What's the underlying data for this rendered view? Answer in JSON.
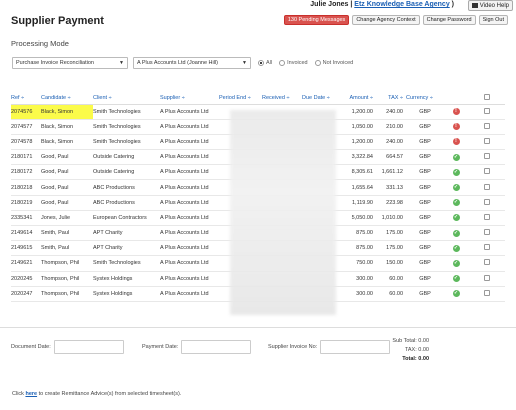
{
  "header": {
    "user_name": "Julie Jones",
    "agency_link": "Etz Knowledge Base Agency",
    "video_help": "Video Help",
    "title": "Supplier Payment",
    "buttons": {
      "pending_messages": "130 Pending Messages",
      "change_agency": "Change Agency Context",
      "change_password": "Change Password",
      "sign_out": "Sign Out"
    }
  },
  "processing_mode_label": "Processing Mode",
  "filters": {
    "mode_select": "Purchase Invoice Reconciliation",
    "supplier_select": "A Plus Accounts Ltd (Joanne Hill)",
    "radios": [
      {
        "label": "All",
        "selected": true
      },
      {
        "label": "Invoiced",
        "selected": false
      },
      {
        "label": "Not Invoiced",
        "selected": false
      }
    ]
  },
  "table": {
    "columns": [
      "Ref ÷",
      "Candidate ÷",
      "Client ÷",
      "Supplier ÷",
      "Period End ÷",
      "Received ÷",
      "Due Date ÷",
      "Amount ÷",
      "TAX ÷",
      "Currency ÷",
      "",
      ""
    ],
    "rows": [
      {
        "ref": "2074576",
        "candidate": "Black, Simon",
        "client": "Smith Technologies",
        "supplier": "A Plus Accounts Ltd",
        "amount": "1,200.00",
        "tax": "240.00",
        "currency": "GBP",
        "status": "bad",
        "highlight": true
      },
      {
        "ref": "2074577",
        "candidate": "Black, Simon",
        "client": "Smith Technologies",
        "supplier": "A Plus Accounts Ltd",
        "amount": "1,050.00",
        "tax": "210.00",
        "currency": "GBP",
        "status": "bad",
        "highlight": false
      },
      {
        "ref": "2074578",
        "candidate": "Black, Simon",
        "client": "Smith Technologies",
        "supplier": "A Plus Accounts Ltd",
        "amount": "1,200.00",
        "tax": "240.00",
        "currency": "GBP",
        "status": "bad",
        "highlight": false
      },
      {
        "ref": "2180171",
        "candidate": "Good, Paul",
        "client": "Outside Catering",
        "supplier": "A Plus Accounts Ltd",
        "amount": "3,322.84",
        "tax": "664.57",
        "currency": "GBP",
        "status": "good",
        "highlight": false
      },
      {
        "ref": "2180172",
        "candidate": "Good, Paul",
        "client": "Outside Catering",
        "supplier": "A Plus Accounts Ltd",
        "amount": "8,305.61",
        "tax": "1,661.12",
        "currency": "GBP",
        "status": "good",
        "highlight": false
      },
      {
        "ref": "2180218",
        "candidate": "Good, Paul",
        "client": "ABC Productions",
        "supplier": "A Plus Accounts Ltd",
        "amount": "1,655.64",
        "tax": "331.13",
        "currency": "GBP",
        "status": "good",
        "highlight": false
      },
      {
        "ref": "2180219",
        "candidate": "Good, Paul",
        "client": "ABC Productions",
        "supplier": "A Plus Accounts Ltd",
        "amount": "1,119.90",
        "tax": "223.98",
        "currency": "GBP",
        "status": "good",
        "highlight": false
      },
      {
        "ref": "2335341",
        "candidate": "Jones, Julie",
        "client": "European Contractors",
        "supplier": "A Plus Accounts Ltd",
        "amount": "5,050.00",
        "tax": "1,010.00",
        "currency": "GBP",
        "status": "good",
        "highlight": false
      },
      {
        "ref": "2149614",
        "candidate": "Smith, Paul",
        "client": "APT Charity",
        "supplier": "A Plus Accounts Ltd",
        "amount": "875.00",
        "tax": "175.00",
        "currency": "GBP",
        "status": "good",
        "highlight": false
      },
      {
        "ref": "2149615",
        "candidate": "Smith, Paul",
        "client": "APT Charity",
        "supplier": "A Plus Accounts Ltd",
        "amount": "875.00",
        "tax": "175.00",
        "currency": "GBP",
        "status": "good",
        "highlight": false
      },
      {
        "ref": "2149621",
        "candidate": "Thompson, Phil",
        "client": "Smith Technologies",
        "supplier": "A Plus Accounts Ltd",
        "amount": "750.00",
        "tax": "150.00",
        "currency": "GBP",
        "status": "good",
        "highlight": false
      },
      {
        "ref": "2020245",
        "candidate": "Thompson, Phil",
        "client": "Systex Holdings",
        "supplier": "A Plus Accounts Ltd",
        "amount": "300.00",
        "tax": "60.00",
        "currency": "GBP",
        "status": "good",
        "highlight": false
      },
      {
        "ref": "2020247",
        "candidate": "Thompson, Phil",
        "client": "Systex Holdings",
        "supplier": "A Plus Accounts Ltd",
        "amount": "300.00",
        "tax": "60.00",
        "currency": "GBP",
        "status": "good",
        "highlight": false
      }
    ]
  },
  "footer_fields": {
    "document_date": "Document Date:",
    "payment_date": "Payment Date:",
    "supplier_invoice_no": "Supplier Invoice No:"
  },
  "totals": {
    "sub_total": "Sub Total: 0.00",
    "tax": "TAX: 0.00",
    "total": "Total: 0.00"
  },
  "footer_note": {
    "prefix": "Click",
    "link": "here",
    "suffix": "to create Remittance Advice(s) from selected timesheet(s)."
  },
  "colors": {
    "link": "#1a5fb4",
    "alert": "#d9534f",
    "ok": "#5cb85c",
    "highlight": "#fbfb4a"
  }
}
